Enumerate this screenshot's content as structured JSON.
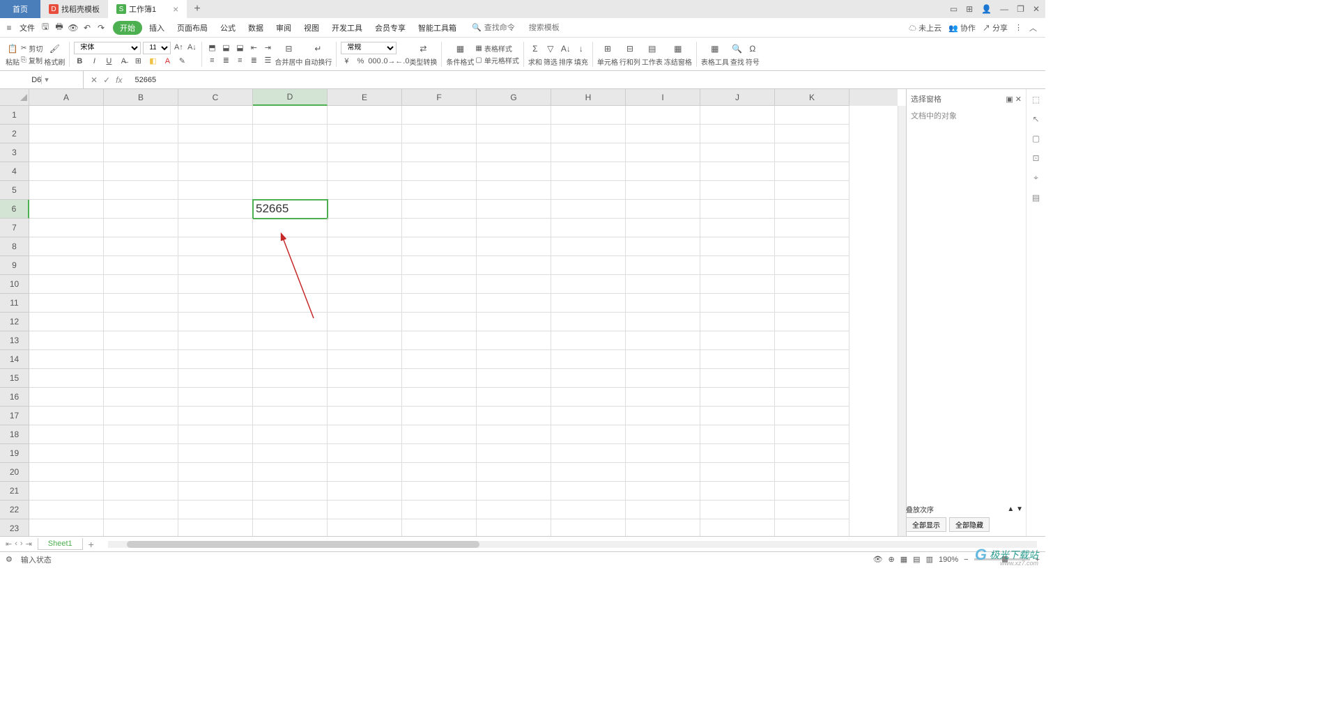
{
  "title_tabs": {
    "home": "首页",
    "template": "找稻壳模板",
    "workbook": "工作簿1"
  },
  "window_controls": {
    "layout": "▭",
    "grid": "⊞",
    "user": "👤",
    "min": "—",
    "max": "❐",
    "close": "✕"
  },
  "menu": {
    "file": "文件",
    "start": "开始",
    "items": [
      "插入",
      "页面布局",
      "公式",
      "数据",
      "审阅",
      "视图",
      "开发工具",
      "会员专享",
      "智能工具箱"
    ],
    "search_cmd": "查找命令",
    "search_tpl": "搜索模板",
    "right": {
      "cloud": "未上云",
      "collab": "协作",
      "share": "分享"
    }
  },
  "ribbon": {
    "paste": "粘贴",
    "cut": "剪切",
    "copy": "复制",
    "format_painter": "格式刷",
    "font": "宋体",
    "size": "11",
    "merge": "合并居中",
    "wrap": "自动换行",
    "general": "常规",
    "type_convert": "类型转换",
    "cond_fmt": "条件格式",
    "table_style": "表格样式",
    "cell_style": "单元格样式",
    "sum": "求和",
    "filter": "筛选",
    "sort": "排序",
    "fill": "填充",
    "cell": "单元格",
    "row_col": "行和列",
    "worksheet": "工作表",
    "freeze": "冻结窗格",
    "table_tool": "表格工具",
    "find": "查找",
    "symbol": "符号"
  },
  "formula_bar": {
    "name": "D6",
    "value": "52665"
  },
  "columns": [
    "A",
    "B",
    "C",
    "D",
    "E",
    "F",
    "G",
    "H",
    "I",
    "J",
    "K"
  ],
  "rows": [
    "1",
    "2",
    "3",
    "4",
    "5",
    "6",
    "7",
    "8",
    "9",
    "10",
    "11",
    "12",
    "13",
    "14",
    "15",
    "16",
    "17",
    "18",
    "19",
    "20",
    "21",
    "22",
    "23"
  ],
  "active": {
    "col": "D",
    "row": "6",
    "value": "52665"
  },
  "right_panel": {
    "title": "选择窗格",
    "subtitle": "文档中的对象",
    "stack": "叠放次序",
    "show_all": "全部显示",
    "hide_all": "全部隐藏"
  },
  "sheet_tabs": {
    "sheet": "Sheet1"
  },
  "status": {
    "mode": "输入状态",
    "zoom": "190%"
  },
  "watermark": {
    "text": "极光下载站",
    "sub": "www.xz7.com"
  }
}
